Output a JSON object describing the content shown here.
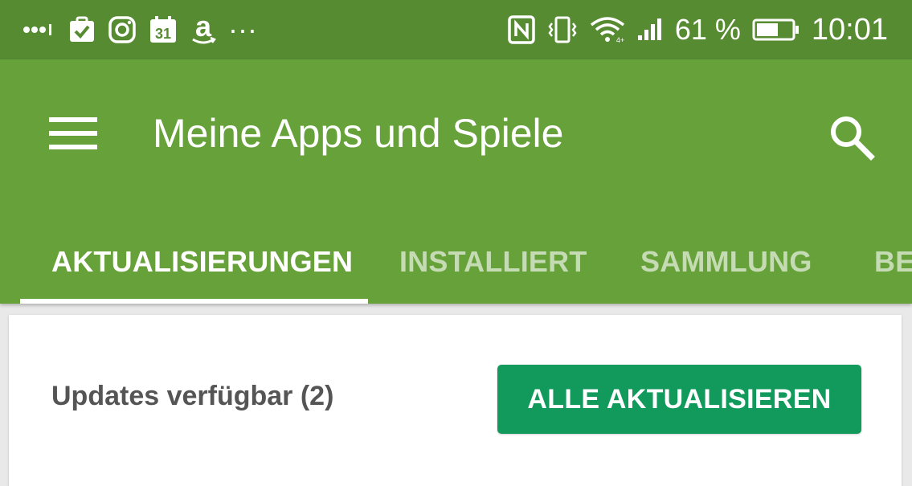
{
  "status_bar": {
    "left_icons": [
      "more-dots-icon",
      "task-check-icon",
      "instagram-icon",
      "calendar-icon",
      "amazon-icon",
      "ellipsis-icon"
    ],
    "calendar_day": "31",
    "amazon_letter": "a",
    "ellipsis": "···",
    "right_icons": [
      "nfc-icon",
      "vibrate-icon",
      "wifi-icon",
      "signal-icon",
      "battery-icon"
    ],
    "battery_percent": "61 %",
    "battery_level": 0.61,
    "time": "10:01"
  },
  "app_bar": {
    "title": "Meine Apps und Spiele",
    "menu_icon": "hamburger-menu-icon",
    "search_icon": "search-icon",
    "color": "#67a139",
    "status_color": "#568b32"
  },
  "tabs": [
    {
      "label": "AKTUALISIERUNGEN",
      "active": true
    },
    {
      "label": "INSTALLIERT",
      "active": false
    },
    {
      "label": "SAMMLUNG",
      "active": false
    },
    {
      "label": "BETA",
      "active": false
    }
  ],
  "updates_card": {
    "label": "Updates verfügbar (2)",
    "button_label": "ALLE AKTUALISIEREN",
    "button_color": "#119a5b"
  }
}
